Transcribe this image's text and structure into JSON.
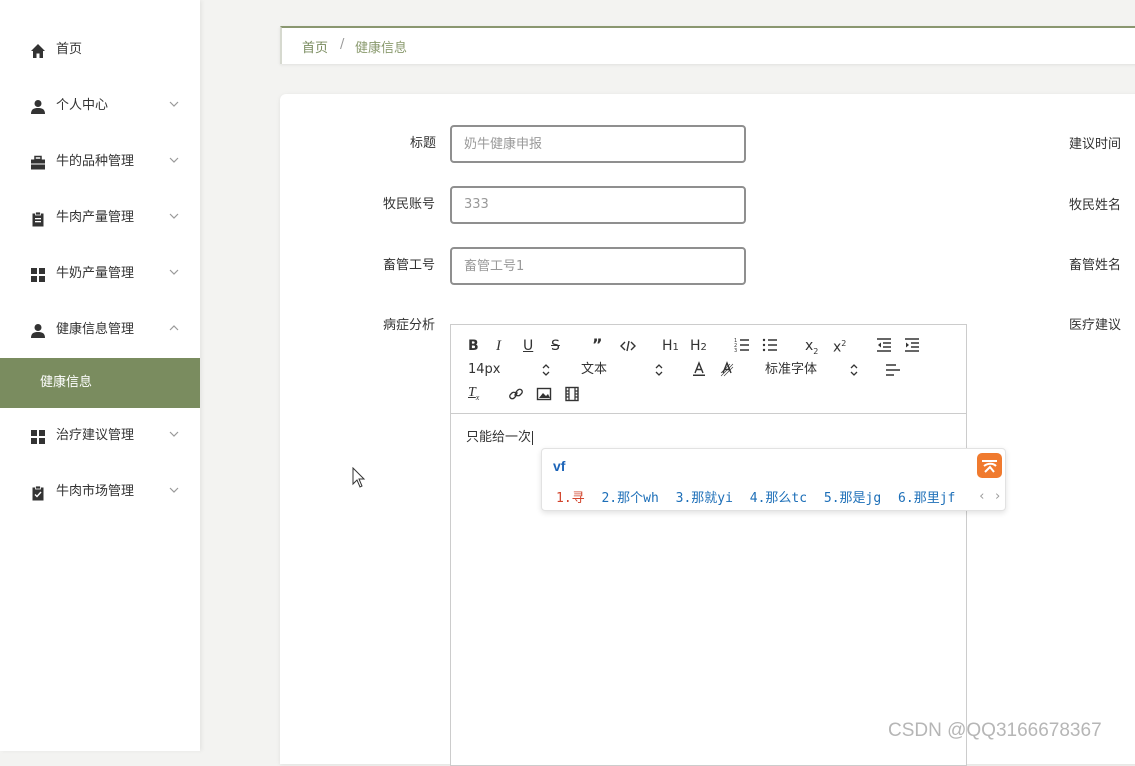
{
  "sidebar": {
    "items": [
      {
        "label": "首页",
        "icon": "home-icon",
        "has_arrow": false
      },
      {
        "label": "个人中心",
        "icon": "user-icon",
        "has_arrow": true
      },
      {
        "label": "牛的品种管理",
        "icon": "briefcase-icon",
        "has_arrow": true
      },
      {
        "label": "牛肉产量管理",
        "icon": "clipboard-icon",
        "has_arrow": true
      },
      {
        "label": "牛奶产量管理",
        "icon": "grid-icon",
        "has_arrow": true
      },
      {
        "label": "健康信息管理",
        "icon": "user-icon",
        "has_arrow": true,
        "expanded": true
      },
      {
        "label": "治疗建议管理",
        "icon": "grid-icon",
        "has_arrow": true
      },
      {
        "label": "牛肉市场管理",
        "icon": "clipboard-check-icon",
        "has_arrow": true
      }
    ],
    "active_sub_item": "健康信息"
  },
  "breadcrumb": {
    "home": "首页",
    "separator": "/",
    "current": "健康信息"
  },
  "form": {
    "title_label": "标题",
    "title_placeholder": "奶牛健康申报",
    "account_label": "牧民账号",
    "account_value": "333",
    "staff_no_label": "畜管工号",
    "staff_no_placeholder": "畜管工号1",
    "symptom_label": "病症分析",
    "right_labels": {
      "advice_time": "建议时间",
      "herder_name": "牧民姓名",
      "staff_name": "畜管姓名",
      "medical_advice": "医疗建议"
    }
  },
  "editor": {
    "toolbar": {
      "font_size": "14px",
      "text_type": "文本",
      "font_family": "标准字体"
    },
    "content": "只能给一次"
  },
  "ime": {
    "input": "vf",
    "candidates": [
      "1.寻",
      "2.那个wh",
      "3.那就yi",
      "4.那么tc",
      "5.那是jg",
      "6.那里jf"
    ],
    "nav": "‹ ›"
  },
  "watermark": "CSDN @QQ3166678367",
  "colors": {
    "accent": "#7a8c5f",
    "ime_logo": "#f07a2e",
    "candidate": "#1d6fb8",
    "candidate_first": "#d2442c"
  }
}
